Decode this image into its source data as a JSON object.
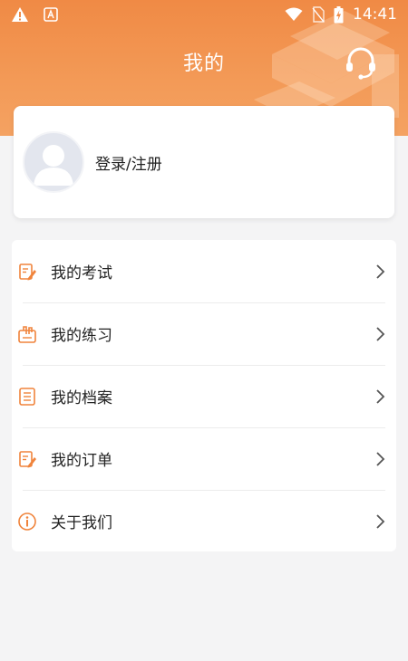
{
  "status_bar": {
    "time": "14:41",
    "icons": [
      "warning-icon",
      "app-notification-icon",
      "wifi-icon",
      "no-sim-icon",
      "battery-charging-icon"
    ]
  },
  "header": {
    "title": "我的",
    "service_icon": "headset-icon",
    "color": "#f08a45"
  },
  "profile": {
    "login_label": "登录/注册",
    "avatar_icon": "default-avatar-icon"
  },
  "menu": {
    "items": [
      {
        "label": "我的考试",
        "icon": "exam-edit-icon"
      },
      {
        "label": "我的练习",
        "icon": "practice-icon"
      },
      {
        "label": "我的档案",
        "icon": "document-icon"
      },
      {
        "label": "我的订单",
        "icon": "order-edit-icon"
      },
      {
        "label": "关于我们",
        "icon": "info-icon"
      }
    ],
    "accent": "#f0843c"
  }
}
